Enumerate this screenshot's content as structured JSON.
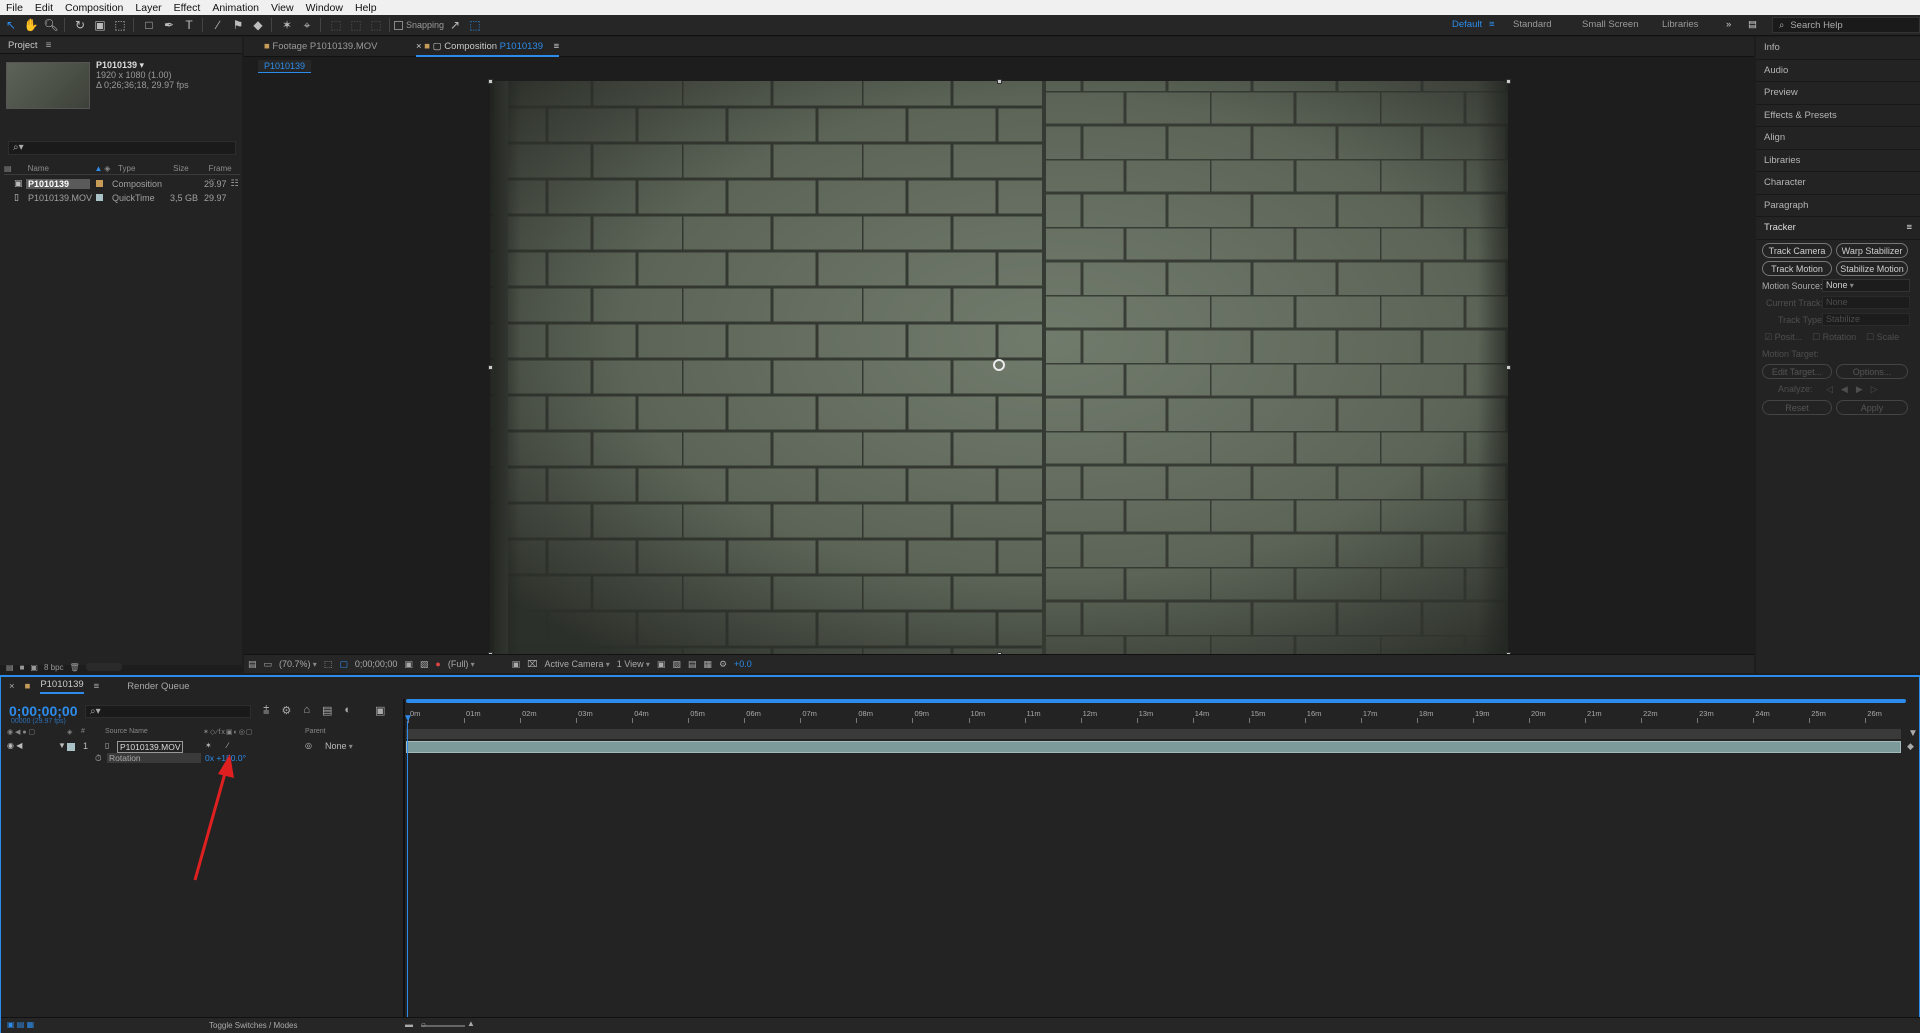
{
  "menu": [
    "File",
    "Edit",
    "Composition",
    "Layer",
    "Effect",
    "Animation",
    "View",
    "Window",
    "Help"
  ],
  "toolbar": {
    "snapping": "Snapping",
    "workspaces": [
      "Default",
      "Standard",
      "Small Screen",
      "Libraries"
    ],
    "active_workspace": "Default",
    "search_help_placeholder": "Search Help"
  },
  "project": {
    "tab": "Project",
    "selected_name": "P1010139 ▾",
    "selected_res": "1920 x 1080 (1.00)",
    "selected_dur": "Δ 0;26;36;18, 29.97 fps",
    "search_placeholder": "",
    "columns": [
      "Name",
      "Type",
      "Size",
      "Frame ..."
    ],
    "items": [
      {
        "name": "P1010139",
        "type": "Composition",
        "size": "",
        "fps": "29.97"
      },
      {
        "name": "P1010139.MOV",
        "type": "QuickTime",
        "size": "3,5 GB",
        "fps": "29.97"
      }
    ],
    "bpc": "8 bpc"
  },
  "viewer": {
    "tab_footage": "Footage P1010139.MOV",
    "tab_comp_prefix": "Composition",
    "tab_comp_name": "P1010139",
    "crumb": "P1010139",
    "zoom": "(70.7%)",
    "timecode": "0;00;00;00",
    "resolution": "(Full)",
    "camera": "Active Camera",
    "views": "1 View",
    "exposure": "+0.0"
  },
  "right_panel": {
    "items": [
      "Info",
      "Audio",
      "Preview",
      "Effects & Presets",
      "Align",
      "Libraries",
      "Character",
      "Paragraph"
    ],
    "tracker": {
      "title": "Tracker",
      "buttons": [
        "Track Camera",
        "Warp Stabilizer",
        "Track Motion",
        "Stabilize Motion"
      ],
      "motion_source_label": "Motion Source:",
      "motion_source_value": "None",
      "current_track_label": "Current Track:",
      "current_track_value": "None",
      "track_type_label": "Track Type:",
      "track_type_value": "Stabilize",
      "checks": [
        "Posit...",
        "Rotation",
        "Scale"
      ],
      "motion_target": "Motion Target:",
      "edit_target": "Edit Target...",
      "options": "Options...",
      "analyze": "Analyze:",
      "reset": "Reset",
      "apply": "Apply"
    }
  },
  "timeline": {
    "comp_tab": "P1010139",
    "render_queue": "Render Queue",
    "timecode": "0;00;00;00",
    "fps_sub": "00000 (29.97 fps)",
    "col_source": "Source Name",
    "col_parent": "Parent",
    "layer": {
      "num": "1",
      "name": "P1010139.MOV",
      "parent": "None"
    },
    "property": {
      "name": "Rotation",
      "value": "0x +180.0°"
    },
    "ruler": [
      "0m",
      "01m",
      "02m",
      "03m",
      "04m",
      "05m",
      "06m",
      "07m",
      "08m",
      "09m",
      "10m",
      "11m",
      "12m",
      "13m",
      "14m",
      "15m",
      "16m",
      "17m",
      "18m",
      "19m",
      "20m",
      "21m",
      "22m",
      "23m",
      "24m",
      "25m",
      "26m"
    ],
    "toggle": "Toggle Switches / Modes"
  },
  "colors": {
    "accent": "#2d8ceb",
    "arrow": "#e02020",
    "layer_bar": "#7c9a9a"
  }
}
